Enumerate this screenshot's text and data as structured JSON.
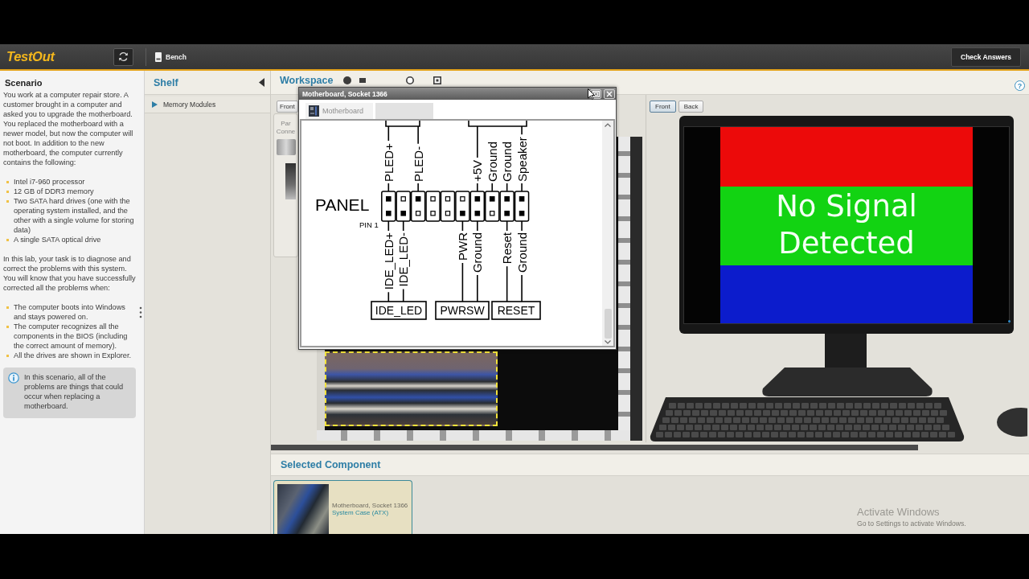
{
  "top_bar": {
    "logo": "TestOut",
    "bench": "Bench",
    "check_answers": "Check Answers"
  },
  "scenario": {
    "title": "Scenario",
    "intro": "You work at a computer repair store. A customer brought in a computer and asked you to upgrade the motherboard. You replaced the motherboard with a newer model, but now the computer will not boot. In addition to the new motherboard, the computer currently contains the following:",
    "components": [
      "Intel i7-960 processor",
      "12 GB of DDR3 memory",
      "Two SATA hard drives (one with the operating system installed, and the other with a single volume for storing data)",
      "A single SATA optical drive"
    ],
    "task": "In this lab, your task is to diagnose and correct the problems with this system. You will know that you have successfully corrected all the problems when:",
    "criteria": [
      "The computer boots into Windows and stays powered on.",
      "The computer recognizes all the components in the BIOS (including the correct amount of memory).",
      "All the drives are shown in Explorer."
    ],
    "note": "In this scenario, all of the problems are things that could occur when replacing a motherboard."
  },
  "shelf": {
    "title": "Shelf",
    "items": [
      {
        "label": "Memory Modules",
        "expanded": false
      }
    ]
  },
  "workspace": {
    "title": "Workspace",
    "help": "?",
    "bench_view": {
      "buttons": [
        {
          "label": "Front",
          "selected": false
        }
      ],
      "parts_panel": "Par Conne",
      "motherboard": {
        "selected": true
      }
    },
    "monitor_view": {
      "buttons": [
        {
          "label": "Front",
          "selected": true
        },
        {
          "label": "Back",
          "selected": false
        }
      ],
      "screen_message": "No Signal Detected"
    }
  },
  "selected_component": {
    "title": "Selected Component",
    "card": {
      "name": "Motherboard, Socket 1366",
      "location": "System Case (ATX)",
      "selected": true
    }
  },
  "window": {
    "title": "Motherboard, Socket 1366",
    "tabs": [
      {
        "label": "Motherboard",
        "selected": false
      },
      {
        "selected": true
      }
    ],
    "diagram": {
      "header_label": "PANEL",
      "pin1_label": "PIN 1",
      "top_row": [
        {
          "label": "PLED+",
          "used": true
        },
        {
          "used": false
        },
        {
          "label": "PLED-",
          "used": true
        },
        {
          "used": false
        },
        {
          "used": false
        },
        {
          "used": false
        },
        {
          "label": "+5V",
          "used": true
        },
        {
          "label": "Ground",
          "used": true
        },
        {
          "label": "Ground",
          "used": true
        },
        {
          "label": "Speaker",
          "used": true
        }
      ],
      "bottom_row": [
        {
          "label": "IDE_LED+",
          "used": true
        },
        {
          "label": "IDE_LED-",
          "used": true
        },
        {
          "used": false
        },
        {
          "used": false
        },
        {
          "used": false
        },
        {
          "label": "PWR",
          "used": true
        },
        {
          "label": "Ground",
          "used": true
        },
        {
          "used": false
        },
        {
          "label": "Reset",
          "used": true
        },
        {
          "label": "Ground",
          "used": true
        }
      ],
      "bottom_connectors": [
        {
          "label": "IDE_LED"
        },
        {
          "label": "PWRSW"
        },
        {
          "label": "RESET"
        }
      ]
    }
  },
  "os_notice": {
    "title": "Activate Windows",
    "subtitle": "Go to Settings to activate Windows."
  }
}
